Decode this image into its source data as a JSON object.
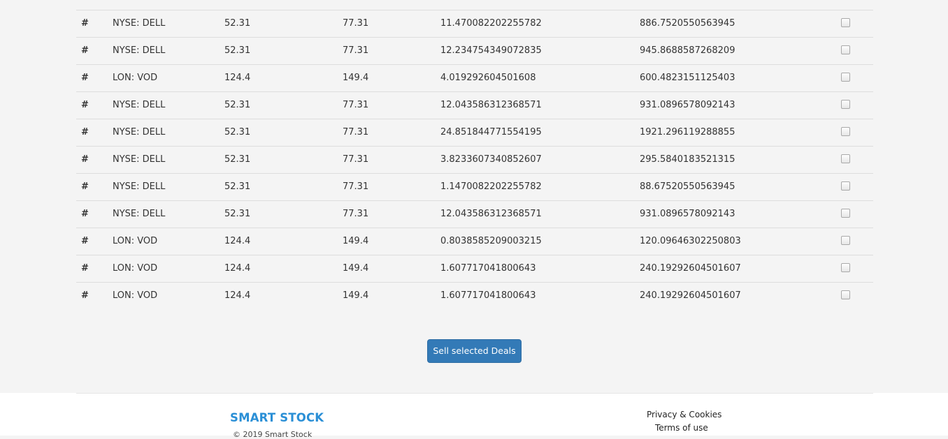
{
  "deals": {
    "rows": [
      {
        "hash": "#",
        "symbol": "",
        "buy": "",
        "sell": "",
        "quantity": "",
        "value": "",
        "partial": true
      },
      {
        "hash": "#",
        "symbol": "NYSE: DELL",
        "buy": "52.31",
        "sell": "77.31",
        "quantity": "11.470082202255782",
        "value": "886.7520550563945"
      },
      {
        "hash": "#",
        "symbol": "NYSE: DELL",
        "buy": "52.31",
        "sell": "77.31",
        "quantity": "12.234754349072835",
        "value": "945.8688587268209"
      },
      {
        "hash": "#",
        "symbol": "LON: VOD",
        "buy": "124.4",
        "sell": "149.4",
        "quantity": "4.019292604501608",
        "value": "600.4823151125403"
      },
      {
        "hash": "#",
        "symbol": "NYSE: DELL",
        "buy": "52.31",
        "sell": "77.31",
        "quantity": "12.043586312368571",
        "value": "931.0896578092143"
      },
      {
        "hash": "#",
        "symbol": "NYSE: DELL",
        "buy": "52.31",
        "sell": "77.31",
        "quantity": "24.851844771554195",
        "value": "1921.296119288855"
      },
      {
        "hash": "#",
        "symbol": "NYSE: DELL",
        "buy": "52.31",
        "sell": "77.31",
        "quantity": "3.8233607340852607",
        "value": "295.5840183521315"
      },
      {
        "hash": "#",
        "symbol": "NYSE: DELL",
        "buy": "52.31",
        "sell": "77.31",
        "quantity": "1.1470082202255782",
        "value": "88.67520550563945"
      },
      {
        "hash": "#",
        "symbol": "NYSE: DELL",
        "buy": "52.31",
        "sell": "77.31",
        "quantity": "12.043586312368571",
        "value": "931.0896578092143"
      },
      {
        "hash": "#",
        "symbol": "LON: VOD",
        "buy": "124.4",
        "sell": "149.4",
        "quantity": "0.8038585209003215",
        "value": "120.09646302250803"
      },
      {
        "hash": "#",
        "symbol": "LON: VOD",
        "buy": "124.4",
        "sell": "149.4",
        "quantity": "1.607717041800643",
        "value": "240.19292604501607"
      },
      {
        "hash": "#",
        "symbol": "LON: VOD",
        "buy": "124.4",
        "sell": "149.4",
        "quantity": "1.607717041800643",
        "value": "240.19292604501607"
      }
    ],
    "sell_button_label": "Sell selected Deals"
  },
  "footer": {
    "brand": "SMART STOCK",
    "copyright": "© 2019 Smart Stock",
    "links": {
      "privacy": "Privacy & Cookies",
      "terms": "Terms of use"
    }
  },
  "colors": {
    "page_background": "#f4f4f4",
    "button_primary": "#337ab7",
    "brand_blue": "#2a8fd6"
  },
  "icons": {
    "row_checkbox": "checkbox-icon"
  }
}
